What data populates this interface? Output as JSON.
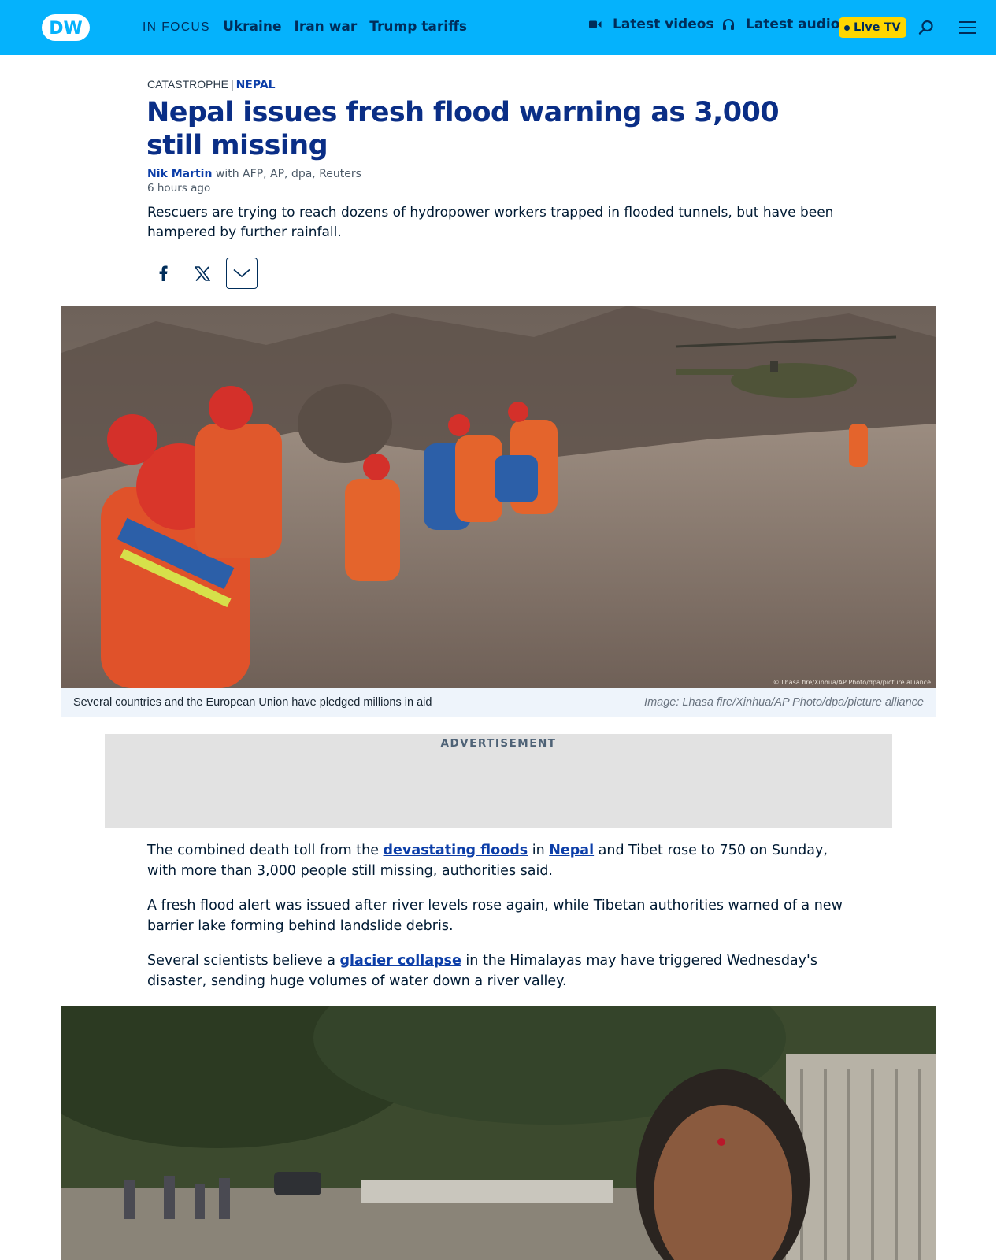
{
  "header": {
    "logo_text": "DW",
    "in_focus_label": "IN FOCUS",
    "focus_topics": [
      "Ukraine",
      "Iran war",
      "Trump tariffs"
    ],
    "latest_videos": "Latest videos",
    "latest_audio": "Latest audio",
    "live_tv": "Live TV",
    "icons": {
      "videos": "video-camera-icon",
      "audio": "headphones-icon",
      "search": "search-icon",
      "menu": "hamburger-menu-icon"
    },
    "colors": {
      "bar": "#05b2fc",
      "live": "#ffd600",
      "text": "#002d5a"
    }
  },
  "article": {
    "category": "CATASTROPHE",
    "separator": "|",
    "tag": "NEPAL",
    "title": "Nepal issues fresh flood warning as 3,000 still missing",
    "author": "Nik Martin",
    "sources": "with AFP, AP, dpa, Reuters",
    "timestamp": "6 hours ago",
    "teaser": "Rescuers are trying to reach dozens of hydropower workers trapped in flooded tunnels, but have been hampered by further rainfall.",
    "share_icons": [
      "facebook-icon",
      "x-icon",
      "chevron-down-icon"
    ],
    "hero_image": {
      "caption": "Several countries and the European Union have pledged millions in aid",
      "credit": "Image: Lhasa fire/Xinhua/AP Photo/dpa/picture alliance",
      "watermark": "© Lhasa fire/Xinhua/AP Photo/dpa/picture alliance"
    },
    "advertisement_label": "ADVERTISEMENT",
    "paragraphs": [
      {
        "p1": "The combined death toll from the ",
        "link1": "devastating floods",
        "p2": " in ",
        "link2": "Nepal",
        "p3": " and Tibet rose to 750 on Sunday, with more than 3,000 people still missing, authorities said."
      },
      {
        "text": "A fresh flood alert was issued after river levels rose again, while Tibetan authorities warned of a new barrier lake forming behind landslide debris."
      },
      {
        "p1": "Several scientists believe a ",
        "link1": "glacier collapse",
        "p3": " in the Himalayas may have triggered Wednesday's disaster, sending huge volumes of water down a river valley."
      }
    ],
    "colors": {
      "title": "#0a2e86",
      "link": "#0c3ea8"
    }
  }
}
